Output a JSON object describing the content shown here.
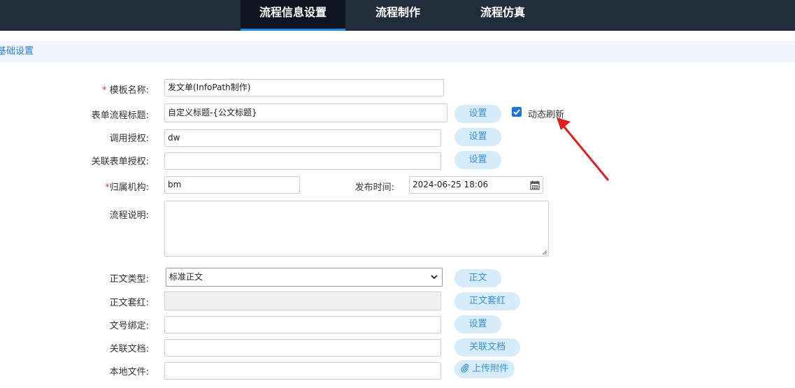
{
  "tabs": [
    {
      "label": "流程信息设置",
      "active": true
    },
    {
      "label": "流程制作",
      "active": false
    },
    {
      "label": "流程仿真",
      "active": false
    }
  ],
  "section": {
    "title": "基础设置"
  },
  "form": {
    "template_name": {
      "required_mark": "*",
      "label": "模板名称:",
      "value": "发文单(InfoPath制作)"
    },
    "form_flow_title": {
      "label": "表单流程标题:",
      "value": "自定义标题-{公文标题}",
      "button": "设置",
      "checkbox_label": "动态刷新",
      "checked": true
    },
    "call_auth": {
      "label": "调用授权:",
      "value": "dw",
      "button": "设置"
    },
    "linked_form_auth": {
      "label": "关联表单授权:",
      "value": "",
      "button": "设置"
    },
    "org": {
      "required_mark": "*",
      "label": "归属机构:",
      "value": "bm"
    },
    "publish_time": {
      "label": "发布时间:",
      "value": "2024-06-25 18:06"
    },
    "flow_desc": {
      "label": "流程说明:",
      "value": ""
    },
    "body_type": {
      "label": "正文类型:",
      "value": "标准正文",
      "button": "正文"
    },
    "body_redhead": {
      "label": "正文套红:",
      "value": "",
      "button": "正文套红"
    },
    "doc_no_bind": {
      "label": "文号绑定:",
      "value": "",
      "button": "设置"
    },
    "linked_doc": {
      "label": "关联文档:",
      "value": "",
      "button": "关联文档"
    },
    "local_file": {
      "label": "本地文件:",
      "value": "",
      "button": "上传附件"
    }
  },
  "colors": {
    "topbar": "#222d3c",
    "accent": "#1e88e5",
    "button_bg": "#d6ecfb",
    "button_text": "#3b8fd9",
    "annotation_arrow": "#e02020"
  }
}
